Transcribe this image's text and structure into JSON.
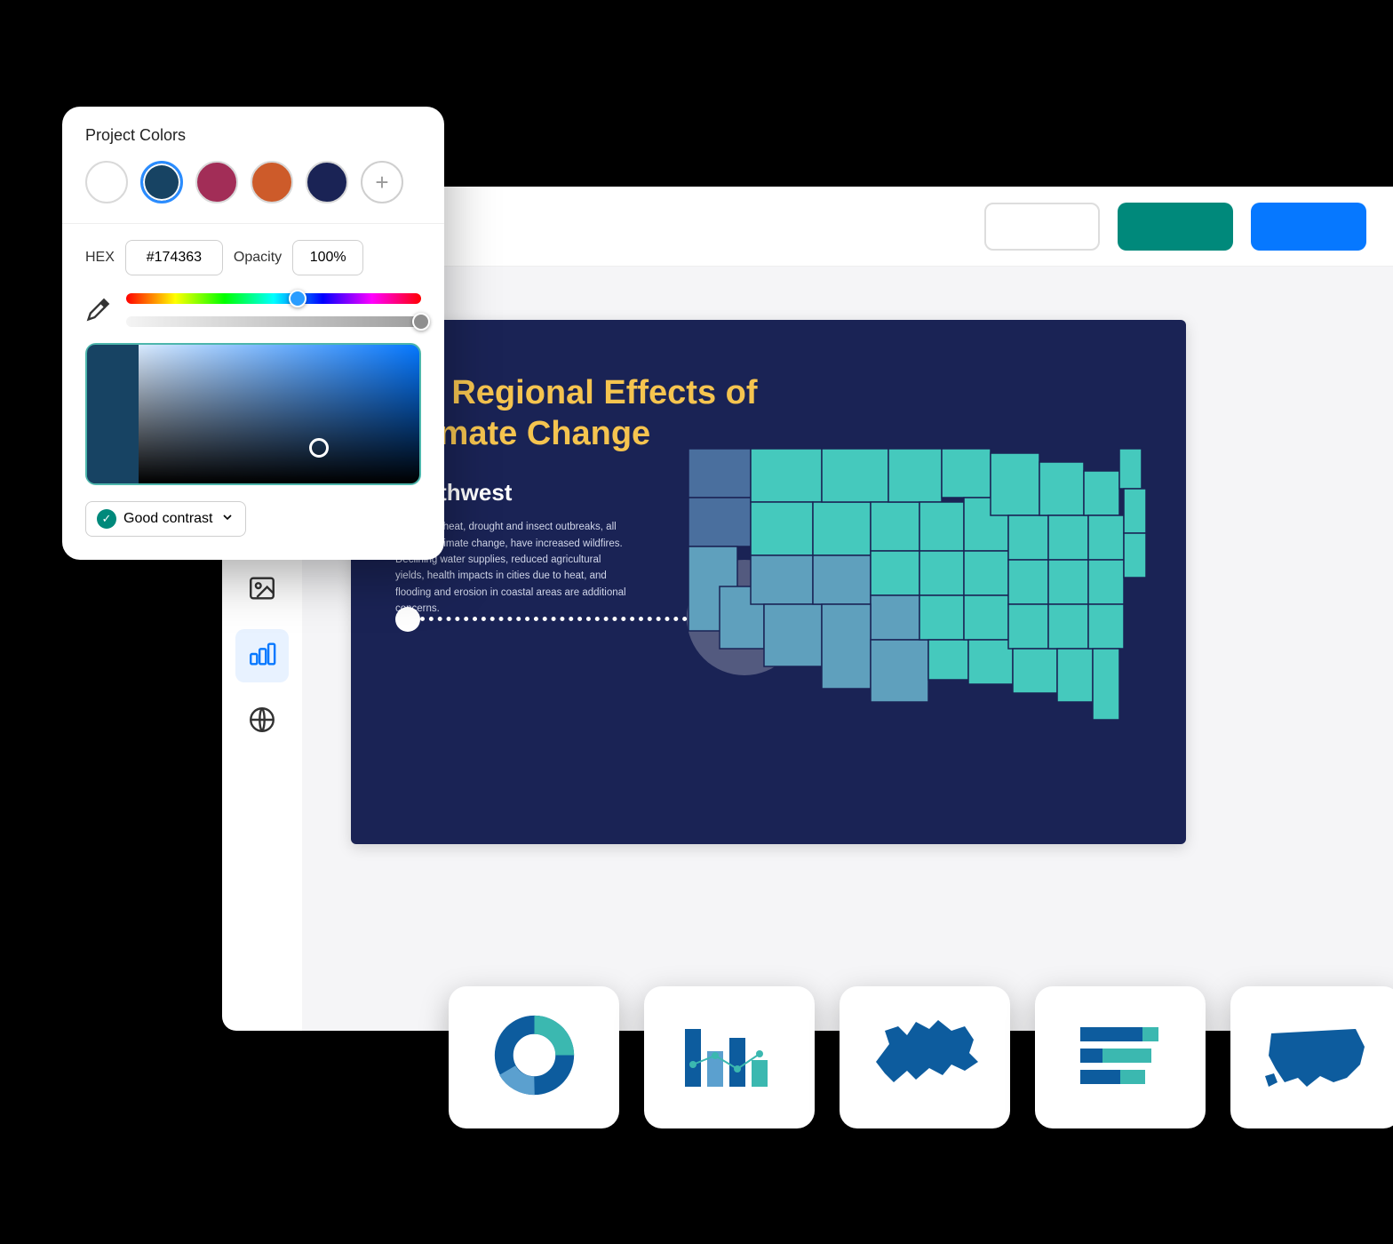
{
  "colorPanel": {
    "title": "Project Colors",
    "swatches": [
      {
        "color": "#ffffff",
        "selected": false
      },
      {
        "color": "#174363",
        "selected": true
      },
      {
        "color": "#a22d57",
        "selected": false
      },
      {
        "color": "#cd5b2a",
        "selected": false
      },
      {
        "color": "#1a2355",
        "selected": false
      }
    ],
    "hexLabel": "HEX",
    "hexValue": "#174363",
    "opacityLabel": "Opacity",
    "opacityValue": "100%",
    "hueThumbPosition": "55%",
    "hueThumbColor": "#2a9dff",
    "opacityThumbPosition": "97%",
    "opacityThumbColor": "#8e8e8e",
    "contrastLabel": "Good contrast",
    "addLabel": "+"
  },
  "slide": {
    "title": "US Regional Effects of Climate Change",
    "region": "Southwest",
    "description": "Increased heat, drought and insect outbreaks, all linked to climate change, have increased wildfires. Declining water supplies, reduced agricultural yields, health impacts in cities due to heat, and flooding and erosion in coastal areas are additional concerns."
  },
  "sidebar": {
    "items": [
      {
        "name": "briefcase-icon",
        "active": false
      },
      {
        "name": "image-icon",
        "active": false
      },
      {
        "name": "chart-icon",
        "active": true
      },
      {
        "name": "globe-icon",
        "active": false
      }
    ]
  },
  "templates": [
    {
      "name": "donut-chart-template"
    },
    {
      "name": "bar-chart-template"
    },
    {
      "name": "canada-map-template"
    },
    {
      "name": "horizontal-bar-template"
    },
    {
      "name": "us-map-template"
    }
  ],
  "headerButtons": {
    "outline": "",
    "teal": "",
    "blue": ""
  }
}
